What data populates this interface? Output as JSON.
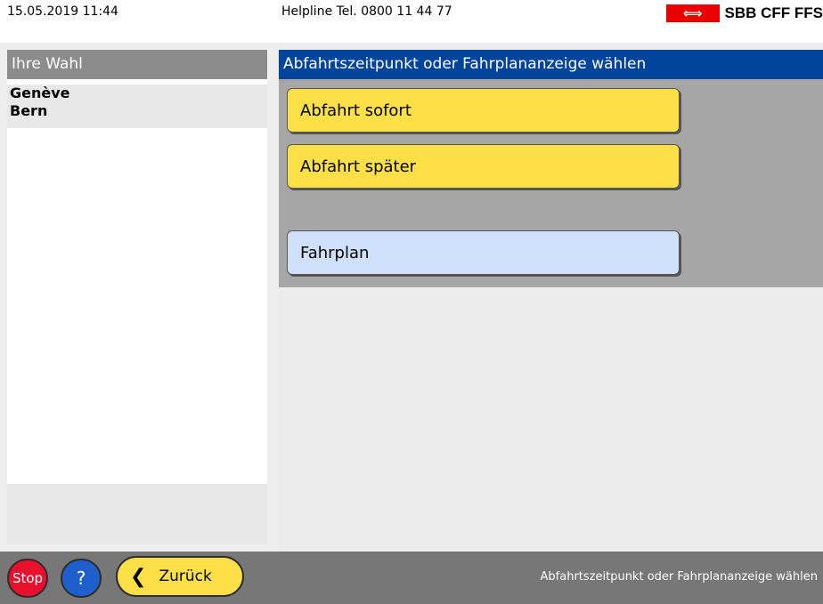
{
  "header": {
    "datetime": "15.05.2019 11:44",
    "helpline": "Helpline  Tel. 0800 11 44 77",
    "logo_text": "SBB CFF FFS",
    "logo_color": "#eb0000"
  },
  "left": {
    "title": "Ihre Wahl",
    "items": [
      "Genève",
      "Bern"
    ]
  },
  "right": {
    "title": "Abfahrtszeitpunkt oder Fahrplananzeige wählen",
    "buttons": {
      "now": "Abfahrt sofort",
      "later": "Abfahrt später",
      "timetable": "Fahrplan"
    }
  },
  "footer": {
    "stop": "Stop",
    "help": "?",
    "back": "Zurück",
    "status": "Abfahrtszeitpunkt oder Fahrplananzeige wählen"
  },
  "colors": {
    "accent_blue": "#00449b",
    "button_yellow": "#fde048",
    "button_blue": "#cfe1fa",
    "stop_red": "#e8102d"
  }
}
